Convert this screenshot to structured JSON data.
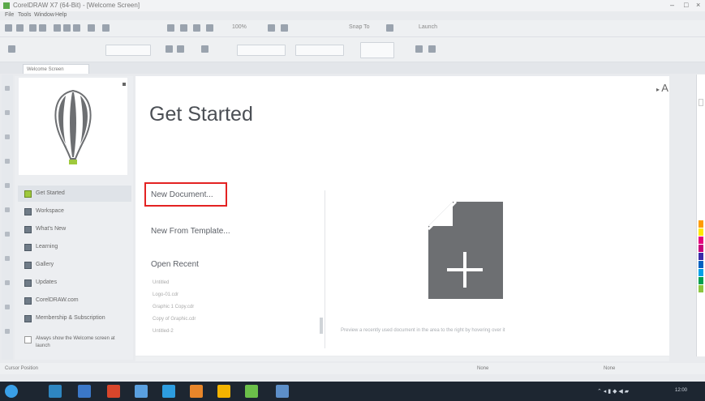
{
  "window": {
    "title": "CorelDRAW X7 (64-Bit) - [Welcome Screen]"
  },
  "menu": [
    "File",
    "Tools",
    "Window",
    "Help"
  ],
  "toolbar": {
    "zoom": "100%",
    "snap_label": "Snap To",
    "launch_label": "Launch"
  },
  "document_tab": "Welcome Screen",
  "sidebar": {
    "items": [
      {
        "label": "Get Started",
        "active": true
      },
      {
        "label": "Workspace"
      },
      {
        "label": "What's New"
      },
      {
        "label": "Learning"
      },
      {
        "label": "Gallery"
      },
      {
        "label": "Updates"
      },
      {
        "label": "CorelDRAW.com"
      },
      {
        "label": "Membership & Subscription"
      }
    ],
    "footer": "Always show the Welcome screen at launch"
  },
  "main": {
    "title": "Get Started",
    "links": {
      "new_document": "New Document...",
      "new_from_template": "New From Template...",
      "open_recent": "Open Recent"
    },
    "recent_files": [
      "Untitled",
      "Logo-01.cdr",
      "Graphic 1 Copy.cdr",
      "Copy of Graphic.cdr",
      "Untitled-2"
    ],
    "preview_caption": "Preview a recently used document in the area to the right by hovering over it",
    "font_toggle": "A"
  },
  "status": {
    "left": "Cursor Position",
    "middle": "None",
    "right": "None"
  },
  "colors": {
    "accent": "#9fc93c",
    "highlight_box": "#e32222",
    "icon_gray": "#6d6f72",
    "taskbar": "#1d2631"
  }
}
